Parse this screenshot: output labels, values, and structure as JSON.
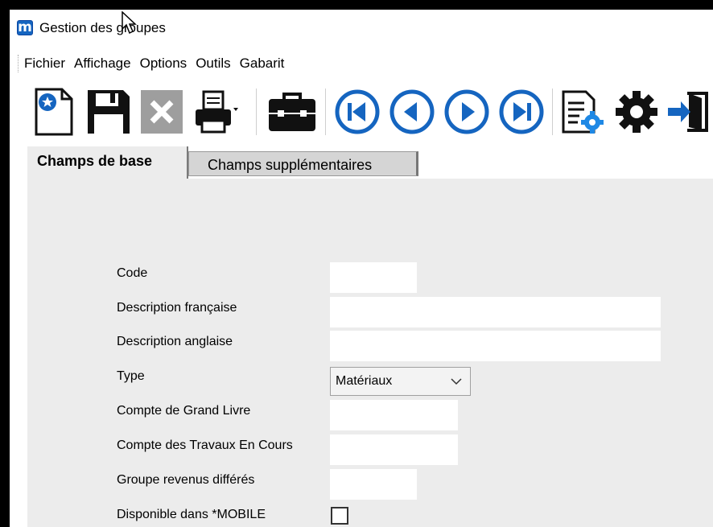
{
  "window": {
    "title": "Gestion des groupes"
  },
  "menu": [
    "Fichier",
    "Affichage",
    "Options",
    "Outils",
    "Gabarit"
  ],
  "toolbar": {
    "icons": [
      "new-document-icon",
      "save-icon",
      "delete-icon",
      "print-icon",
      "briefcase-icon",
      "first-record-icon",
      "previous-record-icon",
      "next-record-icon",
      "last-record-icon",
      "document-settings-icon",
      "gear-icon",
      "exit-icon"
    ]
  },
  "tabs": {
    "active": "Champs de base",
    "inactive": "Champs supplémentaires"
  },
  "form": {
    "code_label": "Code",
    "code_value": "",
    "desc_fr_label": "Description française",
    "desc_fr_value": "",
    "desc_en_label": "Description anglaise",
    "desc_en_value": "",
    "type_label": "Type",
    "type_value": "Matériaux",
    "gl_label": "Compte de Grand Livre",
    "gl_value": "",
    "wip_label": "Compte des Travaux En Cours",
    "wip_value": "",
    "deferred_label": "Groupe revenus différés",
    "deferred_value": "",
    "mobile_label": "Disponible dans *MOBILE",
    "mobile_checked": false
  },
  "colors": {
    "nav_blue": "#1565c0",
    "app_blue": "#1565c0",
    "panel_gray": "#ececec"
  }
}
